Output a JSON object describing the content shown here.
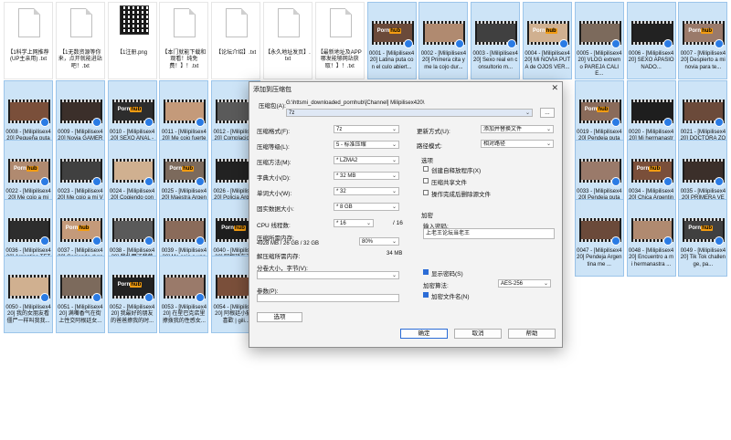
{
  "files": [
    {
      "name": "【1科学上网推荐(UP主亲用) .txt",
      "kind": "doc"
    },
    {
      "name": "【1无数资源等你来，点开就能进站吧！.txt",
      "kind": "doc"
    },
    {
      "name": "【1注册.png",
      "kind": "qr"
    },
    {
      "name": "【本门就能下载和观看！纯免费！】！.txt",
      "kind": "doc"
    },
    {
      "name": "【论坛介绍】.txt",
      "kind": "doc"
    },
    {
      "name": "【永久地址发页】.txt",
      "kind": "doc"
    },
    {
      "name": "【最新地址及APP哪发能够网站获取！】！.txt",
      "kind": "doc"
    },
    {
      "name": "0001 - [Milipilisex420] Latina puta con el culo abiert...",
      "kind": "video"
    },
    {
      "name": "0002 - [Milipilisex420] Primera cita y me la cojo dur...",
      "kind": "video"
    },
    {
      "name": "0003 - [Milipilisex420] Sexo real en consultorio m...",
      "kind": "video"
    },
    {
      "name": "0004 - [Milipilisex420] Mi NOVIA PUTA de OJOS VER...",
      "kind": "video"
    },
    {
      "name": "0005 - [Milipilisex420] VLOG extremo PAREJA CALIE...",
      "kind": "video"
    },
    {
      "name": "0006 - [Milipilisex420] SEXO APASIONADO...",
      "kind": "video"
    },
    {
      "name": "0007 - [Milipilisex420] Despierto a mi novia para te...",
      "kind": "video"
    },
    {
      "name": "0008 - [Milipilisex420] Pequeña puta UNIVERSITARI...",
      "kind": "video"
    },
    {
      "name": "0009 - [Milipilisex420] Novia GAMER TETONA me c...",
      "kind": "video"
    },
    {
      "name": "0010 - [Milipilisex420] SEXO ANAL - Me cojo fuert...",
      "kind": "video"
    },
    {
      "name": "0011 - [Milipilisex420] Me cojo fuerte a la PEQUEÑA ...",
      "kind": "video"
    },
    {
      "name": "0012 - [Milipilisex420] Complacio FACIAL CUM...",
      "kind": "video"
    },
    {
      "name": "0019 - [Milipilisex420] Pendeja puta cogiendo fuer...",
      "kind": "video"
    },
    {
      "name": "0020 - [Milipilisex420] Mi hermanastra Argentina me...",
      "kind": "video"
    },
    {
      "name": "0021 - [Milipilisex420] DOCTORA ZORRA cogie...",
      "kind": "video"
    },
    {
      "name": "0022 - [Milipilisex420] Me cojo a mi HERMANAST...",
      "kind": "video"
    },
    {
      "name": "0023 - [Milipilisex420] Me cojo a mi VECINA atrap...",
      "kind": "video"
    },
    {
      "name": "0024 - [Milipilisex420] Cogiendo con DESCONOCID...",
      "kind": "video"
    },
    {
      "name": "0025 - [Milipilisex420] Maestra Argentina se c...",
      "kind": "video"
    },
    {
      "name": "0026 - [Milipilisex420] Policia Argentina ch...",
      "kind": "video"
    },
    {
      "name": "0033 - [Milipilisex420] Pendeja puta me hace acab...",
      "kind": "video"
    },
    {
      "name": "0034 - [Milipilisex420] Chica Argentina puta ATADA y...",
      "kind": "video"
    },
    {
      "name": "0035 - [Milipilisex420] PRIMERA VEZ chupando pija...",
      "kind": "video"
    },
    {
      "name": "0036 - [Milipilisex420] Argentina TETONA cogi...",
      "kind": "video"
    },
    {
      "name": "0037 - [Milipilisex420] Cogiendo duro conhermanast...",
      "kind": "video"
    },
    {
      "name": "0038 - [Milipilisex420] 我扑爾了我熱愛的模特，她开...",
      "kind": "video"
    },
    {
      "name": "0039 - [Milipilisex420] Me cojo a una pendeja teton...",
      "kind": "video"
    },
    {
      "name": "0040 - [Milipilisex420] 阿根廷在這加裏中偷操他鐘...",
      "kind": "video"
    },
    {
      "name": "0047 - [Milipilisex420] Pendeja Argentina me ...",
      "kind": "video"
    },
    {
      "name": "0048 - [Milipilisex420] Encuentro a mi hermanastra ...",
      "kind": "video"
    },
    {
      "name": "0049 - [Milipilisex420] Tik Tok challenge, pa...",
      "kind": "video"
    },
    {
      "name": "0050 - [Milipilisex420] 我的女朋友看僵尸一样叫我我...",
      "kind": "video"
    },
    {
      "name": "0051 - [Milipilisex420] 满嘴香气在街上性交阿根廷女...",
      "kind": "video"
    },
    {
      "name": "0052 - [Milipilisex420] 我最好的朋友的爸爸撩我的时...",
      "kind": "video"
    },
    {
      "name": "0053 - [Milipilisex420] 在星巴克店里撩拨我的性感女...",
      "kind": "video"
    },
    {
      "name": "0054 - [Milipilisex420] 阿根廷小猫咪喜歡 | gili...",
      "kind": "video"
    }
  ],
  "thumb_colors": [
    "#7a4f3a",
    "#3b2f2a",
    "#2d2d2d",
    "#c49a7a",
    "#5a5a5a",
    "#8a6b5a",
    "#1e1e1e",
    "#6b4a3a",
    "#b08a70",
    "#404040",
    "#d0b090",
    "#7c6a5c",
    "#222222",
    "#9a7a6a"
  ],
  "brand_label": {
    "a": "Porn",
    "b": "hub"
  },
  "dialog": {
    "title": "添加到压缩包",
    "close": "✕",
    "archive_label": "压缩包(A):",
    "archive_path": "G:\\httsmi_downloaded_pornhub\\[Channel] Milipilisex420\\",
    "archive_name": "7z",
    "browse": "...",
    "format_label": "压缩格式(F):",
    "format_value": "7z",
    "level_label": "压缩等级(L):",
    "level_value": "5 - 标准压缩",
    "method_label": "压缩方法(M):",
    "method_value": "* LZMA2",
    "dict_label": "字典大小(D):",
    "dict_value": "* 32 MB",
    "word_label": "单词大小(W):",
    "word_value": "* 32",
    "solid_label": "固实数据大小:",
    "solid_value": "* 8 GB",
    "threads_label": "CPU 线程数:",
    "threads_value": "* 16",
    "threads_max": "/ 16",
    "mem_label": "压缩所需内存:",
    "mem_value": "4928 MB / 26 GB / 32 GB",
    "mem_pct": "80%",
    "decomp_label": "解压缩所需内存:",
    "decomp_value": "34 MB",
    "split_label": "分卷大小，字节(V):",
    "params_label": "参数(P):",
    "options_btn": "选项",
    "update_label": "更新方式(U):",
    "update_value": "添加并替换文件",
    "pathmode_label": "路径模式:",
    "pathmode_value": "相对路径",
    "options_group": "选项",
    "opt_sfx": "创建自释放程序(X)",
    "opt_shared": "压缩共享文件",
    "opt_delete": "操作完成后删除源文件",
    "encrypt_group": "加密",
    "pwd_label": "输入密码:",
    "pwd_value": "上老王论坛当老王",
    "show_pwd": "显示密码(S)",
    "enc_method_label": "加密算法:",
    "enc_method_value": "AES-256",
    "enc_names": "加密文件名(N)",
    "ok": "确定",
    "cancel": "取消",
    "help": "帮助"
  }
}
